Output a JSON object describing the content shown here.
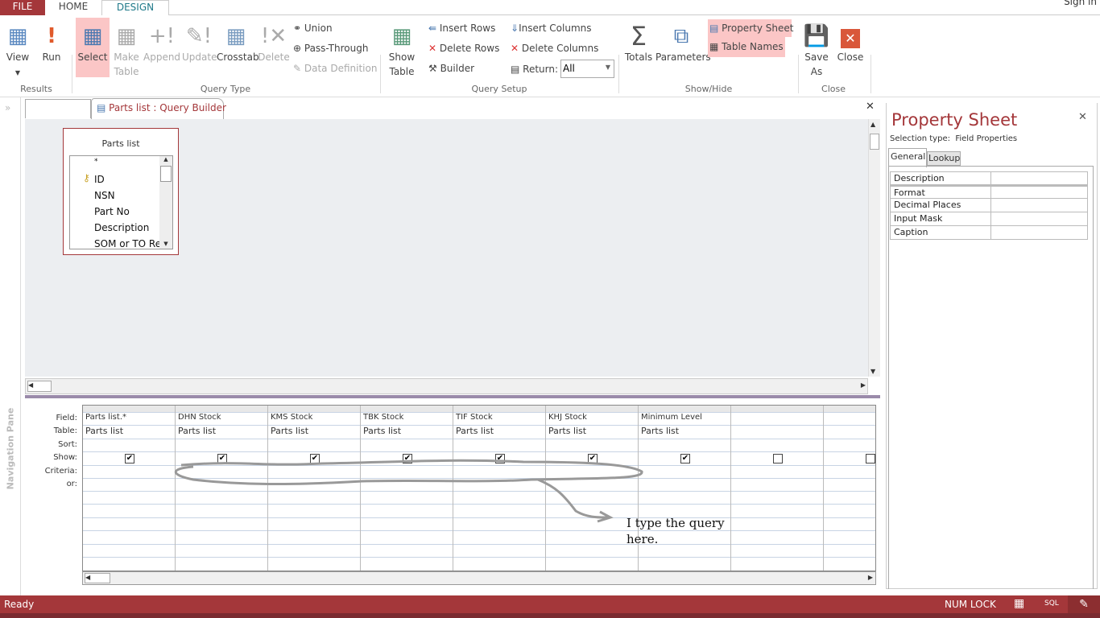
{
  "tabs": {
    "file": "FILE",
    "home": "HOME",
    "design": "DESIGN"
  },
  "signin": "Sign in",
  "ribbon": {
    "results": {
      "label": "Results",
      "view": "View",
      "run": "Run"
    },
    "query_type": {
      "label": "Query Type",
      "select": "Select",
      "make_table": "Make Table",
      "append": "Append",
      "update": "Update",
      "crosstab": "Crosstab",
      "delete": "Delete",
      "union": "Union",
      "pass_through": "Pass-Through",
      "data_definition": "Data Definition"
    },
    "query_setup": {
      "label": "Query Setup",
      "show_table": "Show Table",
      "insert_rows": "Insert Rows",
      "delete_rows": "Delete Rows",
      "builder": "Builder",
      "insert_columns": "Insert Columns",
      "delete_columns": "Delete Columns",
      "return_label": "Return:",
      "return_value": "All"
    },
    "show_hide": {
      "label": "Show/Hide",
      "totals": "Totals",
      "parameters": "Parameters",
      "property_sheet": "Property Sheet",
      "table_names": "Table Names"
    },
    "close": {
      "label": "Close",
      "save_as": "Save As",
      "close": "Close"
    }
  },
  "nav_pane": "Navigation Pane",
  "doc_tab": "Parts list : Query Builder",
  "table_box": {
    "title": "Parts list",
    "fields": [
      "*",
      "ID",
      "NSN",
      "Part No",
      "Description",
      "SOM or TO Refe"
    ]
  },
  "grid": {
    "row_labels": [
      "Field:",
      "Table:",
      "Sort:",
      "Show:",
      "Criteria:",
      "or:"
    ],
    "columns": [
      {
        "field": "Parts list.*",
        "table": "Parts list",
        "show": true
      },
      {
        "field": "DHN Stock",
        "table": "Parts list",
        "show": true
      },
      {
        "field": "KMS Stock",
        "table": "Parts list",
        "show": true
      },
      {
        "field": "TBK Stock",
        "table": "Parts list",
        "show": true
      },
      {
        "field": "TIF Stock",
        "table": "Parts list",
        "show": true
      },
      {
        "field": "KHJ Stock",
        "table": "Parts list",
        "show": true
      },
      {
        "field": "Minimum Level",
        "table": "Parts list",
        "show": true
      },
      {
        "field": "",
        "table": "",
        "show": false
      },
      {
        "field": "",
        "table": "",
        "show": false
      }
    ]
  },
  "annotation": "I type the query here.",
  "property_sheet": {
    "title": "Property Sheet",
    "selection_type": "Selection type:  Field Properties",
    "tabs": [
      "General",
      "Lookup"
    ],
    "rows": [
      "Description",
      "Format",
      "Decimal Places",
      "Input Mask",
      "Caption"
    ]
  },
  "status": {
    "ready": "Ready",
    "num_lock": "NUM LOCK",
    "sql": "SQL"
  }
}
